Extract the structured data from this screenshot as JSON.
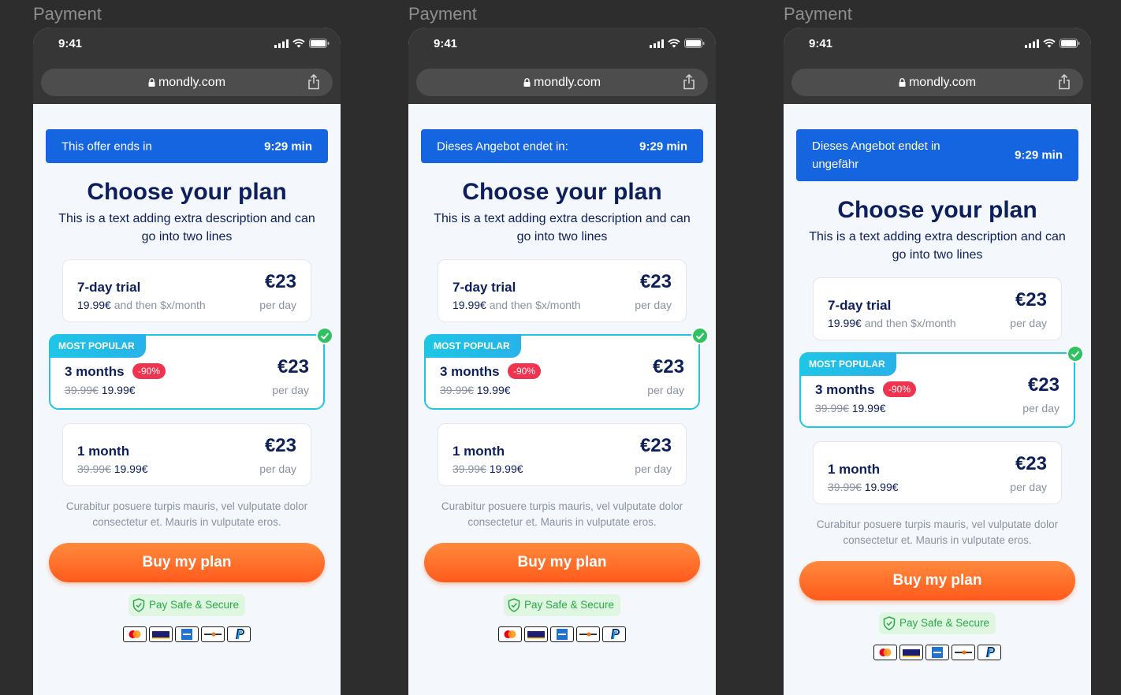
{
  "frames": [
    {
      "label": "Payment",
      "status_time": "9:41",
      "url": "mondly.com",
      "banner": {
        "text": "This offer ends in",
        "timer": "9:29 min"
      },
      "title": "Choose your plan",
      "subtitle": "This is a text adding extra description and can go into two lines",
      "plans": [
        {
          "name": "7-day trial",
          "price_now": "19.99€",
          "price_tail": "and then $x/month",
          "price": "€23",
          "per": "per day"
        },
        {
          "badge": "MOST POPULAR",
          "name": "3 months",
          "discount": "-90%",
          "price_old": "39.99€",
          "price_now": "19.99€",
          "price": "€23",
          "per": "per day"
        },
        {
          "name": "1 month",
          "price_old": "39.99€",
          "price_now": "19.99€",
          "price": "€23",
          "per": "per day"
        }
      ],
      "fineprint": "Curabitur posuere turpis mauris, vel vulputate dolor consectetur et. Mauris in vulputate eros.",
      "cta": "Buy my plan",
      "secure": "Pay Safe & Secure"
    },
    {
      "label": "Payment",
      "status_time": "9:41",
      "url": "mondly.com",
      "banner": {
        "text": "Dieses Angebot endet in:",
        "timer": "9:29 min"
      },
      "title": "Choose your plan",
      "subtitle": "This is a text adding extra description and can go into two lines",
      "plans": [
        {
          "name": "7-day trial",
          "price_now": "19.99€",
          "price_tail": "and then $x/month",
          "price": "€23",
          "per": "per day"
        },
        {
          "badge": "MOST POPULAR",
          "name": "3 months",
          "discount": "-90%",
          "price_old": "39.99€",
          "price_now": "19.99€",
          "price": "€23",
          "per": "per day"
        },
        {
          "name": "1 month",
          "price_old": "39.99€",
          "price_now": "19.99€",
          "price": "€23",
          "per": "per day"
        }
      ],
      "fineprint": "Curabitur posuere turpis mauris, vel vulputate dolor consectetur et. Mauris in vulputate eros.",
      "cta": "Buy my plan",
      "secure": "Pay Safe & Secure"
    },
    {
      "label": "Payment",
      "status_time": "9:41",
      "url": "mondly.com",
      "banner": {
        "text": "Dieses Angebot endet in ungefähr",
        "timer": "9:29 min"
      },
      "title": "Choose your plan",
      "subtitle": "This is a text adding extra description and can go into two lines",
      "plans": [
        {
          "name": "7-day trial",
          "price_now": "19.99€",
          "price_tail": "and then $x/month",
          "price": "€23",
          "per": "per day"
        },
        {
          "badge": "MOST POPULAR",
          "name": "3 months",
          "discount": "-90%",
          "price_old": "39.99€",
          "price_now": "19.99€",
          "price": "€23",
          "per": "per day"
        },
        {
          "name": "1 month",
          "price_old": "39.99€",
          "price_now": "19.99€",
          "price": "€23",
          "per": "per day"
        }
      ],
      "fineprint": "Curabitur posuere turpis mauris, vel vulputate dolor consectetur et. Mauris in vulputate eros.",
      "cta": "Buy my plan",
      "secure": "Pay Safe & Secure"
    }
  ],
  "payment_icons": [
    "mastercard-icon",
    "visa-icon",
    "amex-icon",
    "discover-icon",
    "paypal-icon"
  ],
  "colors": {
    "brand_navy": "#0d1f5c",
    "banner_blue": "#1565e0",
    "accent_cyan": "#1ec6e6",
    "cta_orange": "#ff6a24",
    "discount_red": "#f0334f",
    "secure_green": "#2aa84a"
  }
}
